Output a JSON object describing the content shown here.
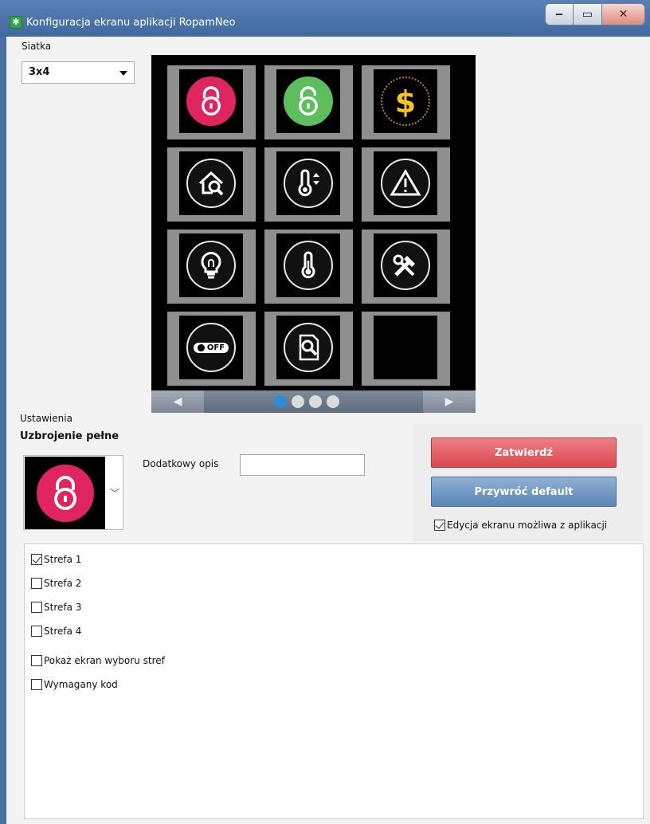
{
  "window": {
    "title": "Konfiguracja ekranu aplikacji RopamNeo",
    "minimize_glyph": "‒",
    "maximize_glyph": "▭",
    "close_glyph": "✕"
  },
  "grid": {
    "label": "Siatka",
    "selected": "3x4"
  },
  "preview": {
    "tiles": [
      {
        "icon": "lock-closed-icon",
        "color": "#e0245e"
      },
      {
        "icon": "lock-open-icon",
        "color": "#5cbf5c"
      },
      {
        "icon": "dollar-icon",
        "color": "#f5c518"
      },
      {
        "icon": "house-search-icon",
        "color": "#ffffff"
      },
      {
        "icon": "thermometer-updown-icon",
        "color": "#ffffff"
      },
      {
        "icon": "warning-icon",
        "color": "#ffffff"
      },
      {
        "icon": "light-bulb-icon",
        "color": "#ffffff"
      },
      {
        "icon": "thermometer-icon",
        "color": "#ffffff"
      },
      {
        "icon": "tools-icon",
        "color": "#ffffff"
      },
      {
        "icon": "off-switch-icon",
        "color": "#ffffff"
      },
      {
        "icon": "document-search-icon",
        "color": "#ffffff"
      },
      {
        "icon": "empty",
        "color": "#000000"
      }
    ],
    "off_text": "OFF",
    "pager": {
      "pages": 4,
      "active_page": 1,
      "left_glyph": "◀",
      "right_glyph": "▶"
    }
  },
  "settings": {
    "section_label": "Ustawienia",
    "selected_function": "Uzbrojenie pełne",
    "picker_chevron": "﹀",
    "description_label": "Dodatkowy opis",
    "description_value": "",
    "confirm_label": "Zatwierdź",
    "reset_label": "Przywróć default",
    "edit_allowed_label": "Edycja ekranu możliwa z aplikacji",
    "edit_allowed": true
  },
  "zones": {
    "items": [
      {
        "label": "Strefa 1",
        "checked": true
      },
      {
        "label": "Strefa 2",
        "checked": false
      },
      {
        "label": "Strefa 3",
        "checked": false
      },
      {
        "label": "Strefa 4",
        "checked": false
      }
    ],
    "show_zone_screen_label": "Pokaż ekran wyboru stref",
    "show_zone_screen": false,
    "code_required_label": "Wymagany kod",
    "code_required": false
  },
  "colors": {
    "confirm": "#d94950",
    "reset": "#5b86b5",
    "pager_active": "#2a8fd8"
  }
}
